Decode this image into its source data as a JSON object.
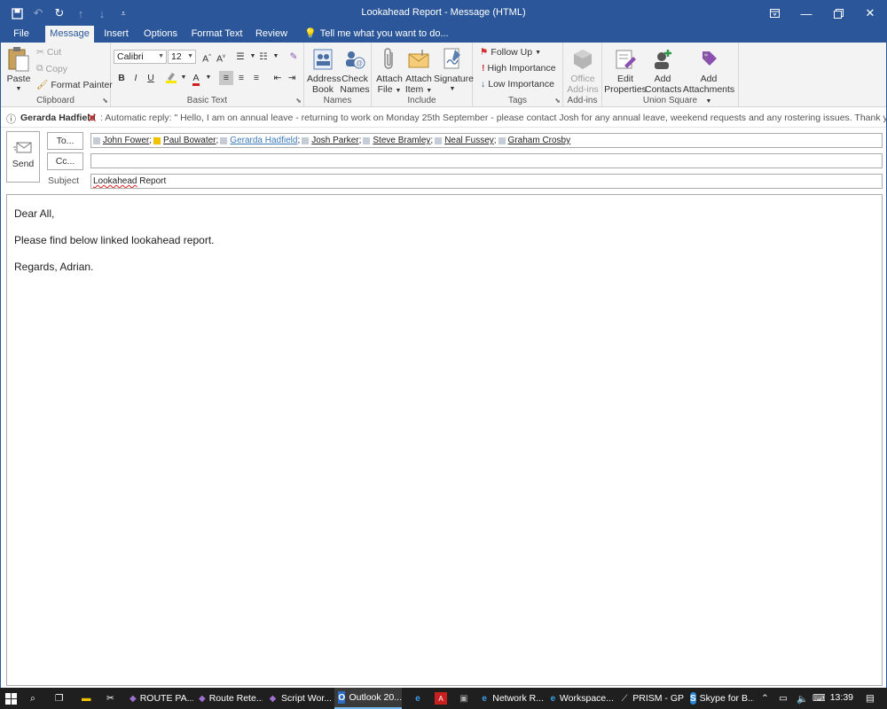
{
  "window": {
    "title": "Lookahead Report - Message (HTML)"
  },
  "tabs": [
    "File",
    "Message",
    "Insert",
    "Options",
    "Format Text",
    "Review"
  ],
  "tell_me": "Tell me what you want to do...",
  "ribbon": {
    "clipboard": {
      "label": "Clipboard",
      "paste": "Paste",
      "cut": "Cut",
      "copy": "Copy",
      "format_painter": "Format Painter"
    },
    "basic_text": {
      "label": "Basic Text",
      "font": "Calibri",
      "size": "12",
      "bold": "B",
      "italic": "I",
      "underline": "U"
    },
    "names": {
      "label": "Names",
      "address_book_1": "Address",
      "address_book_2": "Book",
      "check_names_1": "Check",
      "check_names_2": "Names"
    },
    "include": {
      "label": "Include",
      "attach_file_1": "Attach",
      "attach_file_2": "File",
      "attach_item_1": "Attach",
      "attach_item_2": "Item",
      "signature": "Signature"
    },
    "tags": {
      "label": "Tags",
      "follow_up": "Follow Up",
      "high": "High Importance",
      "low": "Low Importance"
    },
    "addins": {
      "label": "Add-ins",
      "office_1": "Office",
      "office_2": "Add-ins"
    },
    "union": {
      "label": "Union Square",
      "edit_1": "Edit",
      "edit_2": "Properties",
      "contacts_1": "Add",
      "contacts_2": "Contacts",
      "attach_1": "Add",
      "attach_2": "Attachments"
    }
  },
  "infobar": {
    "sender": "Gerarda Hadfield",
    "message": ": Automatic reply: \"   Hello, I am on annual leave - returning to work on Monday 25th September - please contact Josh for any annual leave, weekend requests and any rostering issues.  Thank you.  Gerry\""
  },
  "compose": {
    "send": "Send",
    "to_btn": "To...",
    "cc_btn": "Cc...",
    "subject_label": "Subject",
    "recipients": [
      {
        "name": "John Fower",
        "sep": ";"
      },
      {
        "name": "Paul Bowater",
        "sep": ";"
      },
      {
        "name": "Gerarda Hadfield",
        "sep": ";"
      },
      {
        "name": "Josh Parker",
        "sep": ";"
      },
      {
        "name": "Steve Bramley",
        "sep": ";"
      },
      {
        "name": "Neal Fussey",
        "sep": ";"
      },
      {
        "name": "Graham Crosby",
        "sep": ""
      }
    ],
    "cc": "",
    "subject_word1": "Lookahead",
    "subject_word2": " Report"
  },
  "body": {
    "greeting": "Dear All,",
    "line": "Please find below linked lookahead report.",
    "signoff": "Regards, Adrian."
  },
  "taskbar": {
    "items": [
      "ROUTE PA...",
      "Route Rete...",
      "Script Wor...",
      "Outlook 20...",
      "Network R...",
      "Workspace...",
      "PRISM - GP",
      "Skype for B..."
    ],
    "time": "13:39"
  }
}
